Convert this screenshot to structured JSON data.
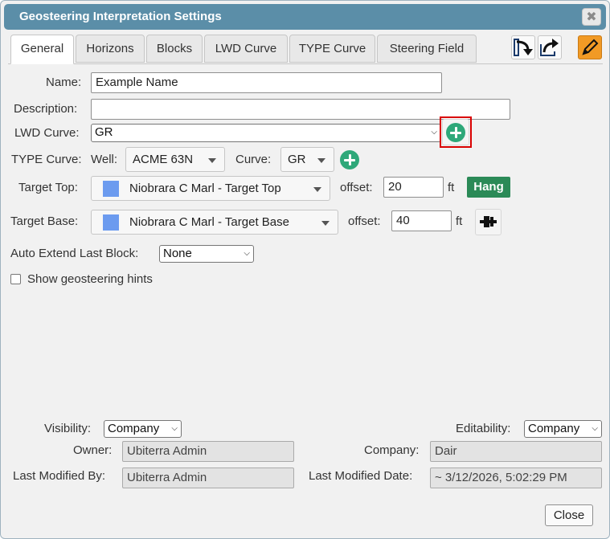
{
  "dialog": {
    "title": "Geosteering Interpretation Settings",
    "close_x": "✖"
  },
  "tabs": [
    {
      "label": "General",
      "active": true
    },
    {
      "label": "Horizons"
    },
    {
      "label": "Blocks"
    },
    {
      "label": "LWD Curve"
    },
    {
      "label": "TYPE Curve"
    },
    {
      "label": "Steering Field"
    }
  ],
  "toolbar": {
    "import_icon": "import-arrow-icon",
    "share_icon": "share-arrow-icon",
    "edit_icon": "pencil-icon"
  },
  "form": {
    "name_label": "Name:",
    "name_value": "Example Name",
    "description_label": "Description:",
    "description_value": "",
    "lwd_label": "LWD Curve:",
    "lwd_value": "GR",
    "type_label": "TYPE Curve:",
    "well_label": "Well:",
    "well_value": "ACME 63N",
    "curve_label": "Curve:",
    "curve_value": "GR",
    "target_top_label": "Target Top:",
    "target_top_value": "Niobrara C Marl - Target Top",
    "offset_label": "offset:",
    "top_offset": "20",
    "unit": "ft",
    "hang_label": "Hang",
    "target_base_label": "Target Base:",
    "target_base_value": "Niobrara C Marl - Target Base",
    "base_offset": "40",
    "auto_extend_label": "Auto Extend Last Block:",
    "auto_extend_value": "None",
    "hints_label": "Show geosteering hints",
    "swatch_color": "#6c9bef",
    "hang_color": "#2b8a57"
  },
  "meta": {
    "visibility_label": "Visibility:",
    "visibility_value": "Company",
    "editability_label": "Editability:",
    "editability_value": "Company",
    "owner_label": "Owner:",
    "owner_value": "Ubiterra Admin",
    "company_label": "Company:",
    "company_value": "Dair",
    "modified_by_label": "Last Modified By:",
    "modified_by_value": "Ubiterra Admin",
    "modified_date_label": "Last Modified Date:",
    "modified_date_value": "~ 3/12/2026, 5:02:29 PM"
  },
  "buttons": {
    "close": "Close"
  }
}
